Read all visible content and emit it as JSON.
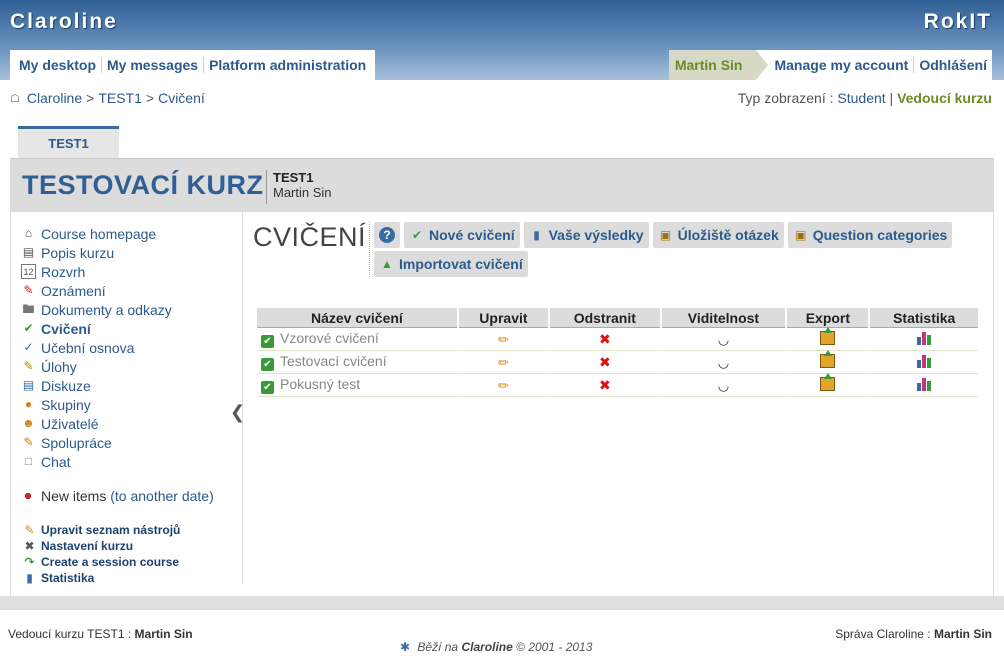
{
  "banner": {
    "brand": "Claroline",
    "institution": "RokIT"
  },
  "nav": {
    "left": [
      "My desktop",
      "My messages",
      "Platform administration"
    ],
    "user": "Martin Sin",
    "right": [
      "Manage my account",
      "Odhlášení"
    ]
  },
  "breadcrumb": {
    "items": [
      "Claroline",
      "TEST1",
      "Cvičení"
    ],
    "separator": ">"
  },
  "view_mode": {
    "label": "Typ zobrazení :",
    "student": "Student",
    "separator": "|",
    "teacher": "Vedoucí kurzu"
  },
  "course": {
    "tab": "TEST1",
    "title": "TESTOVACÍ KURZ",
    "code": "TEST1",
    "teacher": "Martin Sin"
  },
  "tools": [
    {
      "label": "Course homepage",
      "icon": "home-icon"
    },
    {
      "label": "Popis kurzu",
      "icon": "description-icon"
    },
    {
      "label": "Rozvrh",
      "icon": "calendar-icon"
    },
    {
      "label": "Oznámení",
      "icon": "announcement-icon"
    },
    {
      "label": "Dokumenty a odkazy",
      "icon": "folder-icon"
    },
    {
      "label": "Cvičení",
      "icon": "checkbox-icon",
      "active": true
    },
    {
      "label": "Učební osnova",
      "icon": "learnpath-icon"
    },
    {
      "label": "Úlohy",
      "icon": "assignment-icon"
    },
    {
      "label": "Diskuze",
      "icon": "forum-icon"
    },
    {
      "label": "Skupiny",
      "icon": "group-icon"
    },
    {
      "label": "Uživatelé",
      "icon": "user-icon"
    },
    {
      "label": "Spolupráce",
      "icon": "wiki-icon"
    },
    {
      "label": "Chat",
      "icon": "chat-icon"
    }
  ],
  "new_items": {
    "label": "New items",
    "link": "(to another date)"
  },
  "admin_links": [
    {
      "label": "Upravit seznam nástrojů",
      "icon": "pencil-icon"
    },
    {
      "label": "Nastavení kurzu",
      "icon": "settings-icon"
    },
    {
      "label": "Create a session course",
      "icon": "session-icon"
    },
    {
      "label": "Statistika",
      "icon": "statistics-icon"
    }
  ],
  "page": {
    "heading": "CVIČENÍ"
  },
  "commands": [
    {
      "label": "Nové cvičení",
      "icon": "new-exercise-icon"
    },
    {
      "label": "Vaše výsledky",
      "icon": "results-icon"
    },
    {
      "label": "Úložiště otázek",
      "icon": "question-pool-icon"
    },
    {
      "label": "Question categories",
      "icon": "categories-icon"
    },
    {
      "label": "Importovat cvičení",
      "icon": "import-icon"
    }
  ],
  "table": {
    "headers": [
      "Název cvičení",
      "Upravit",
      "Odstranit",
      "Viditelnost",
      "Export",
      "Statistika"
    ],
    "rows": [
      {
        "name": "Vzorové cvičení"
      },
      {
        "name": "Testovací cvičení"
      },
      {
        "name": "Pokusný test"
      }
    ]
  },
  "footer": {
    "left_label": "Vedoucí kurzu TEST1 :",
    "left_name": "Martin Sin",
    "right_label": "Správa Claroline :",
    "right_name": "Martin Sin",
    "powered_prefix": "Běží na",
    "powered_brand": "Claroline",
    "powered_suffix": "© 2001 - 2013"
  }
}
